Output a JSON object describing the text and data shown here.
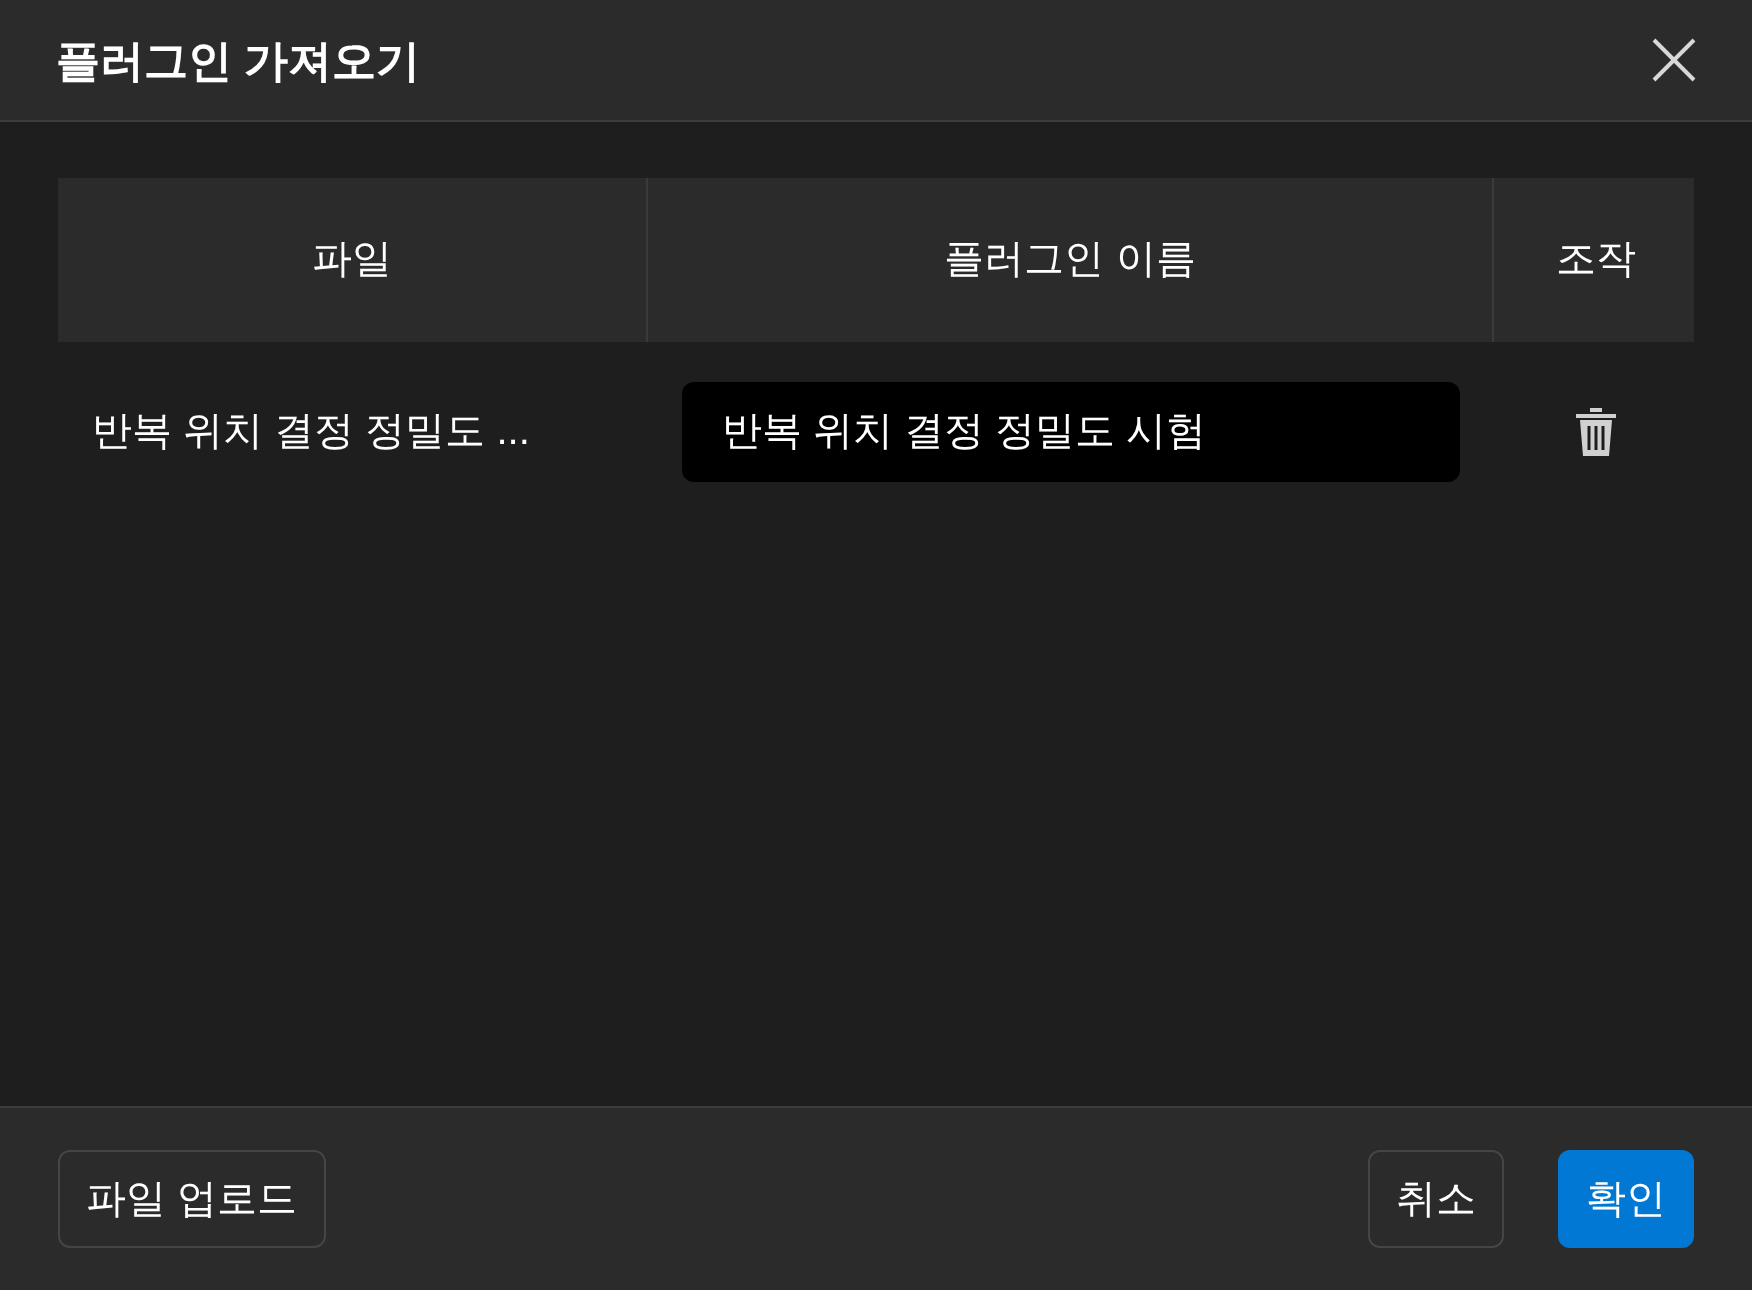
{
  "window": {
    "title": "플러그인 가져오기"
  },
  "table": {
    "columns": [
      "파일",
      "플러그인 이름",
      "조작"
    ],
    "rows": [
      {
        "file": "반복 위치 결정 정밀도 ...",
        "plugin_name": "반복 위치 결정 정밀도 시험"
      }
    ]
  },
  "footer": {
    "upload_button": "파일 업로드",
    "buttons": [
      {
        "label": "취소",
        "kind": "secondary"
      },
      {
        "label": "확인",
        "kind": "primary"
      }
    ]
  }
}
